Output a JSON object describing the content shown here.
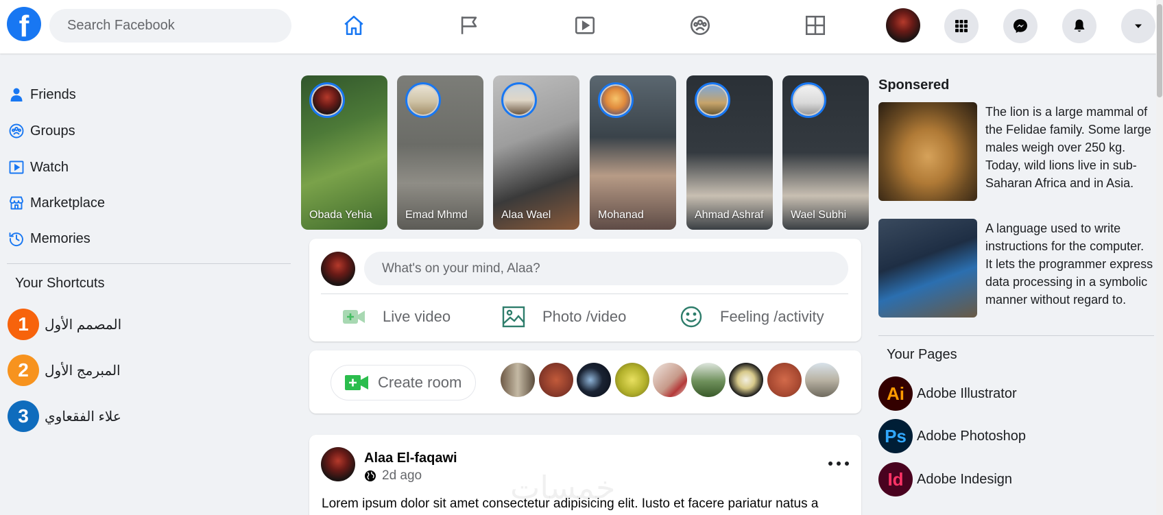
{
  "topbar": {
    "logo_letter": "f",
    "search_placeholder": "Search Facebook",
    "nav_icons": [
      "home-icon",
      "flag-icon",
      "video-play-icon",
      "groups-icon",
      "gaming-grid-icon"
    ],
    "right_icons": [
      "menu-grid-icon",
      "messenger-icon",
      "bell-icon",
      "caret-down-icon"
    ]
  },
  "sidebar": {
    "items": [
      {
        "label": "Friends",
        "icon": "friends-icon"
      },
      {
        "label": "Groups",
        "icon": "groups-icon"
      },
      {
        "label": "Watch",
        "icon": "watch-icon"
      },
      {
        "label": "Marketplace",
        "icon": "marketplace-icon"
      },
      {
        "label": "Memories",
        "icon": "memories-icon"
      }
    ],
    "shortcuts_title": "Your Shortcuts",
    "shortcuts": [
      {
        "num": "1",
        "label": "المصمم الأول",
        "color": "#f7630c"
      },
      {
        "num": "2",
        "label": "المبرمج الأول",
        "color": "#f7931e"
      },
      {
        "num": "3",
        "label": "علاء الفقعاوي",
        "color": "#0f6cbd"
      }
    ]
  },
  "stories": [
    {
      "name": "Obada Yehia"
    },
    {
      "name": "Emad Mhmd"
    },
    {
      "name": "Alaa Wael"
    },
    {
      "name": "Mohanad"
    },
    {
      "name": "Ahmad Ashraf"
    },
    {
      "name": "Wael Subhi"
    }
  ],
  "composer": {
    "placeholder": "What's on your mind, Alaa?",
    "actions": [
      {
        "label": "Live video",
        "icon": "live-video-icon",
        "color": "#45bd62"
      },
      {
        "label": "Photo /video",
        "icon": "photo-icon",
        "color": "#2e7d6b"
      },
      {
        "label": "Feeling /activity",
        "icon": "feeling-icon",
        "color": "#2e7d6b"
      }
    ]
  },
  "rooms": {
    "create_label": "Create room"
  },
  "post": {
    "author": "Alaa El-faqawi",
    "time": "2d ago",
    "text": "Lorem ipsum dolor sit amet consectetur adipisicing elit. Iusto et facere pariatur natus a",
    "watermark": "خمسات"
  },
  "right": {
    "sponsored_title": "Sponsered",
    "ads": [
      {
        "text": "The lion is a large mammal of the Felidae family. Some large males weigh over 250 kg. Today, wild lions live in sub-Saharan Africa and in Asia."
      },
      {
        "text": "A language used to write instructions for the computer. It lets the programmer express data processing in a symbolic manner without regard to."
      }
    ],
    "pages_title": "Your Pages",
    "pages": [
      {
        "abbr": "Ai",
        "name": "Adobe Illustrator",
        "bg": "#330000",
        "fg": "#ff9a00"
      },
      {
        "abbr": "Ps",
        "name": "Adobe Photoshop",
        "bg": "#001e36",
        "fg": "#31a8ff"
      },
      {
        "abbr": "Id",
        "name": "Adobe Indesign",
        "bg": "#49021f",
        "fg": "#ff3366"
      }
    ]
  },
  "colors": {
    "brand": "#1877f2",
    "background": "#f0f2f5"
  }
}
